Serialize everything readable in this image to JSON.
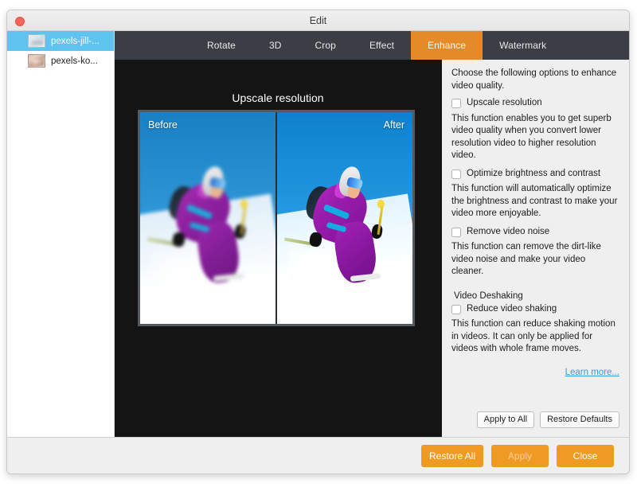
{
  "window": {
    "title": "Edit",
    "close_button": "close"
  },
  "sidebar": {
    "files": [
      {
        "name": "pexels-jill-...",
        "selected": true
      },
      {
        "name": "pexels-ko...",
        "selected": false
      }
    ]
  },
  "tabs": [
    {
      "label": "Rotate",
      "active": false
    },
    {
      "label": "3D",
      "active": false
    },
    {
      "label": "Crop",
      "active": false
    },
    {
      "label": "Effect",
      "active": false
    },
    {
      "label": "Enhance",
      "active": true
    },
    {
      "label": "Watermark",
      "active": false
    }
  ],
  "preview": {
    "title": "Upscale resolution",
    "before_label": "Before",
    "after_label": "After"
  },
  "panel": {
    "intro": "Choose the following options to enhance video quality.",
    "options": [
      {
        "label": "Upscale resolution",
        "checked": false,
        "description": "This function enables you to get superb video quality when you convert lower resolution video to higher resolution video."
      },
      {
        "label": "Optimize brightness and contrast",
        "checked": false,
        "description": "This function will automatically optimize the brightness and contrast to make your video more enjoyable."
      },
      {
        "label": "Remove video noise",
        "checked": false,
        "description": "This function can remove the dirt-like video noise and make your video cleaner."
      }
    ],
    "group_title": "Video Deshaking",
    "deshake_option": {
      "label": "Reduce video shaking",
      "checked": false,
      "description": "This function can reduce shaking motion in videos. It can only be applied for videos with whole frame moves."
    },
    "learn_more": "Learn more...",
    "apply_to_all": "Apply to All",
    "restore_defaults": "Restore Defaults"
  },
  "footer": {
    "restore_all": "Restore All",
    "apply": "Apply",
    "close": "Close"
  },
  "colors": {
    "accent_orange": "#ef9a22",
    "tab_active": "#e58a28",
    "tabbar_bg": "#3b3e45",
    "preview_bg": "#141414",
    "panel_bg": "#efefef",
    "selection_blue": "#5ec3ef",
    "link_blue": "#2e9fe0"
  }
}
